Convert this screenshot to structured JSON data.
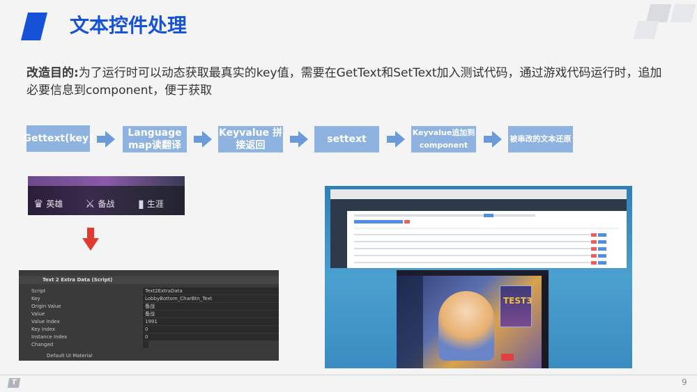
{
  "title": "文本控件处理",
  "paragraph": {
    "label": "改造目的:",
    "text": "为了运行时可以动态获取最真实的key值，需要在GetText和SetText加入测试代码，通过游戏代码运行时，追加必要信息到component，便于获取"
  },
  "flow": [
    {
      "label": "Gettext(key)"
    },
    {
      "label": "Language map读翻译"
    },
    {
      "label": "Keyvalue 拼接返回"
    },
    {
      "label": "settext"
    },
    {
      "label": "Keyvalue追加到component"
    },
    {
      "label": "被串改的文本还原"
    }
  ],
  "game_tabs": [
    {
      "icon": "hero-icon",
      "label": "英雄"
    },
    {
      "icon": "battle-prep-icon",
      "label": "备战"
    },
    {
      "icon": "career-icon",
      "label": "生涯"
    }
  ],
  "inspector": {
    "header": "Text 2 Extra Data (Script)",
    "rows": [
      {
        "label": "Script",
        "value": "Text2ExtraData"
      },
      {
        "label": "Key",
        "value": "LobbyBottom_CharBtn_Text"
      },
      {
        "label": "Origin Value",
        "value": "备战"
      },
      {
        "label": "Value",
        "value": "备战"
      },
      {
        "label": "Value Index",
        "value": "1991"
      },
      {
        "label": "Key Index",
        "value": "0"
      },
      {
        "label": "Instance Index",
        "value": "0"
      },
      {
        "label": "Changed",
        "value": ""
      }
    ],
    "footer": "Default UI Material"
  },
  "game_card_text": "TEST3",
  "page_number": "9",
  "footer_logo": "T",
  "colors": {
    "accent": "#1552d8",
    "step_bg": "#8fb3e0",
    "arrow": "#6b9bd9",
    "red_arrow": "#e03b2f"
  }
}
